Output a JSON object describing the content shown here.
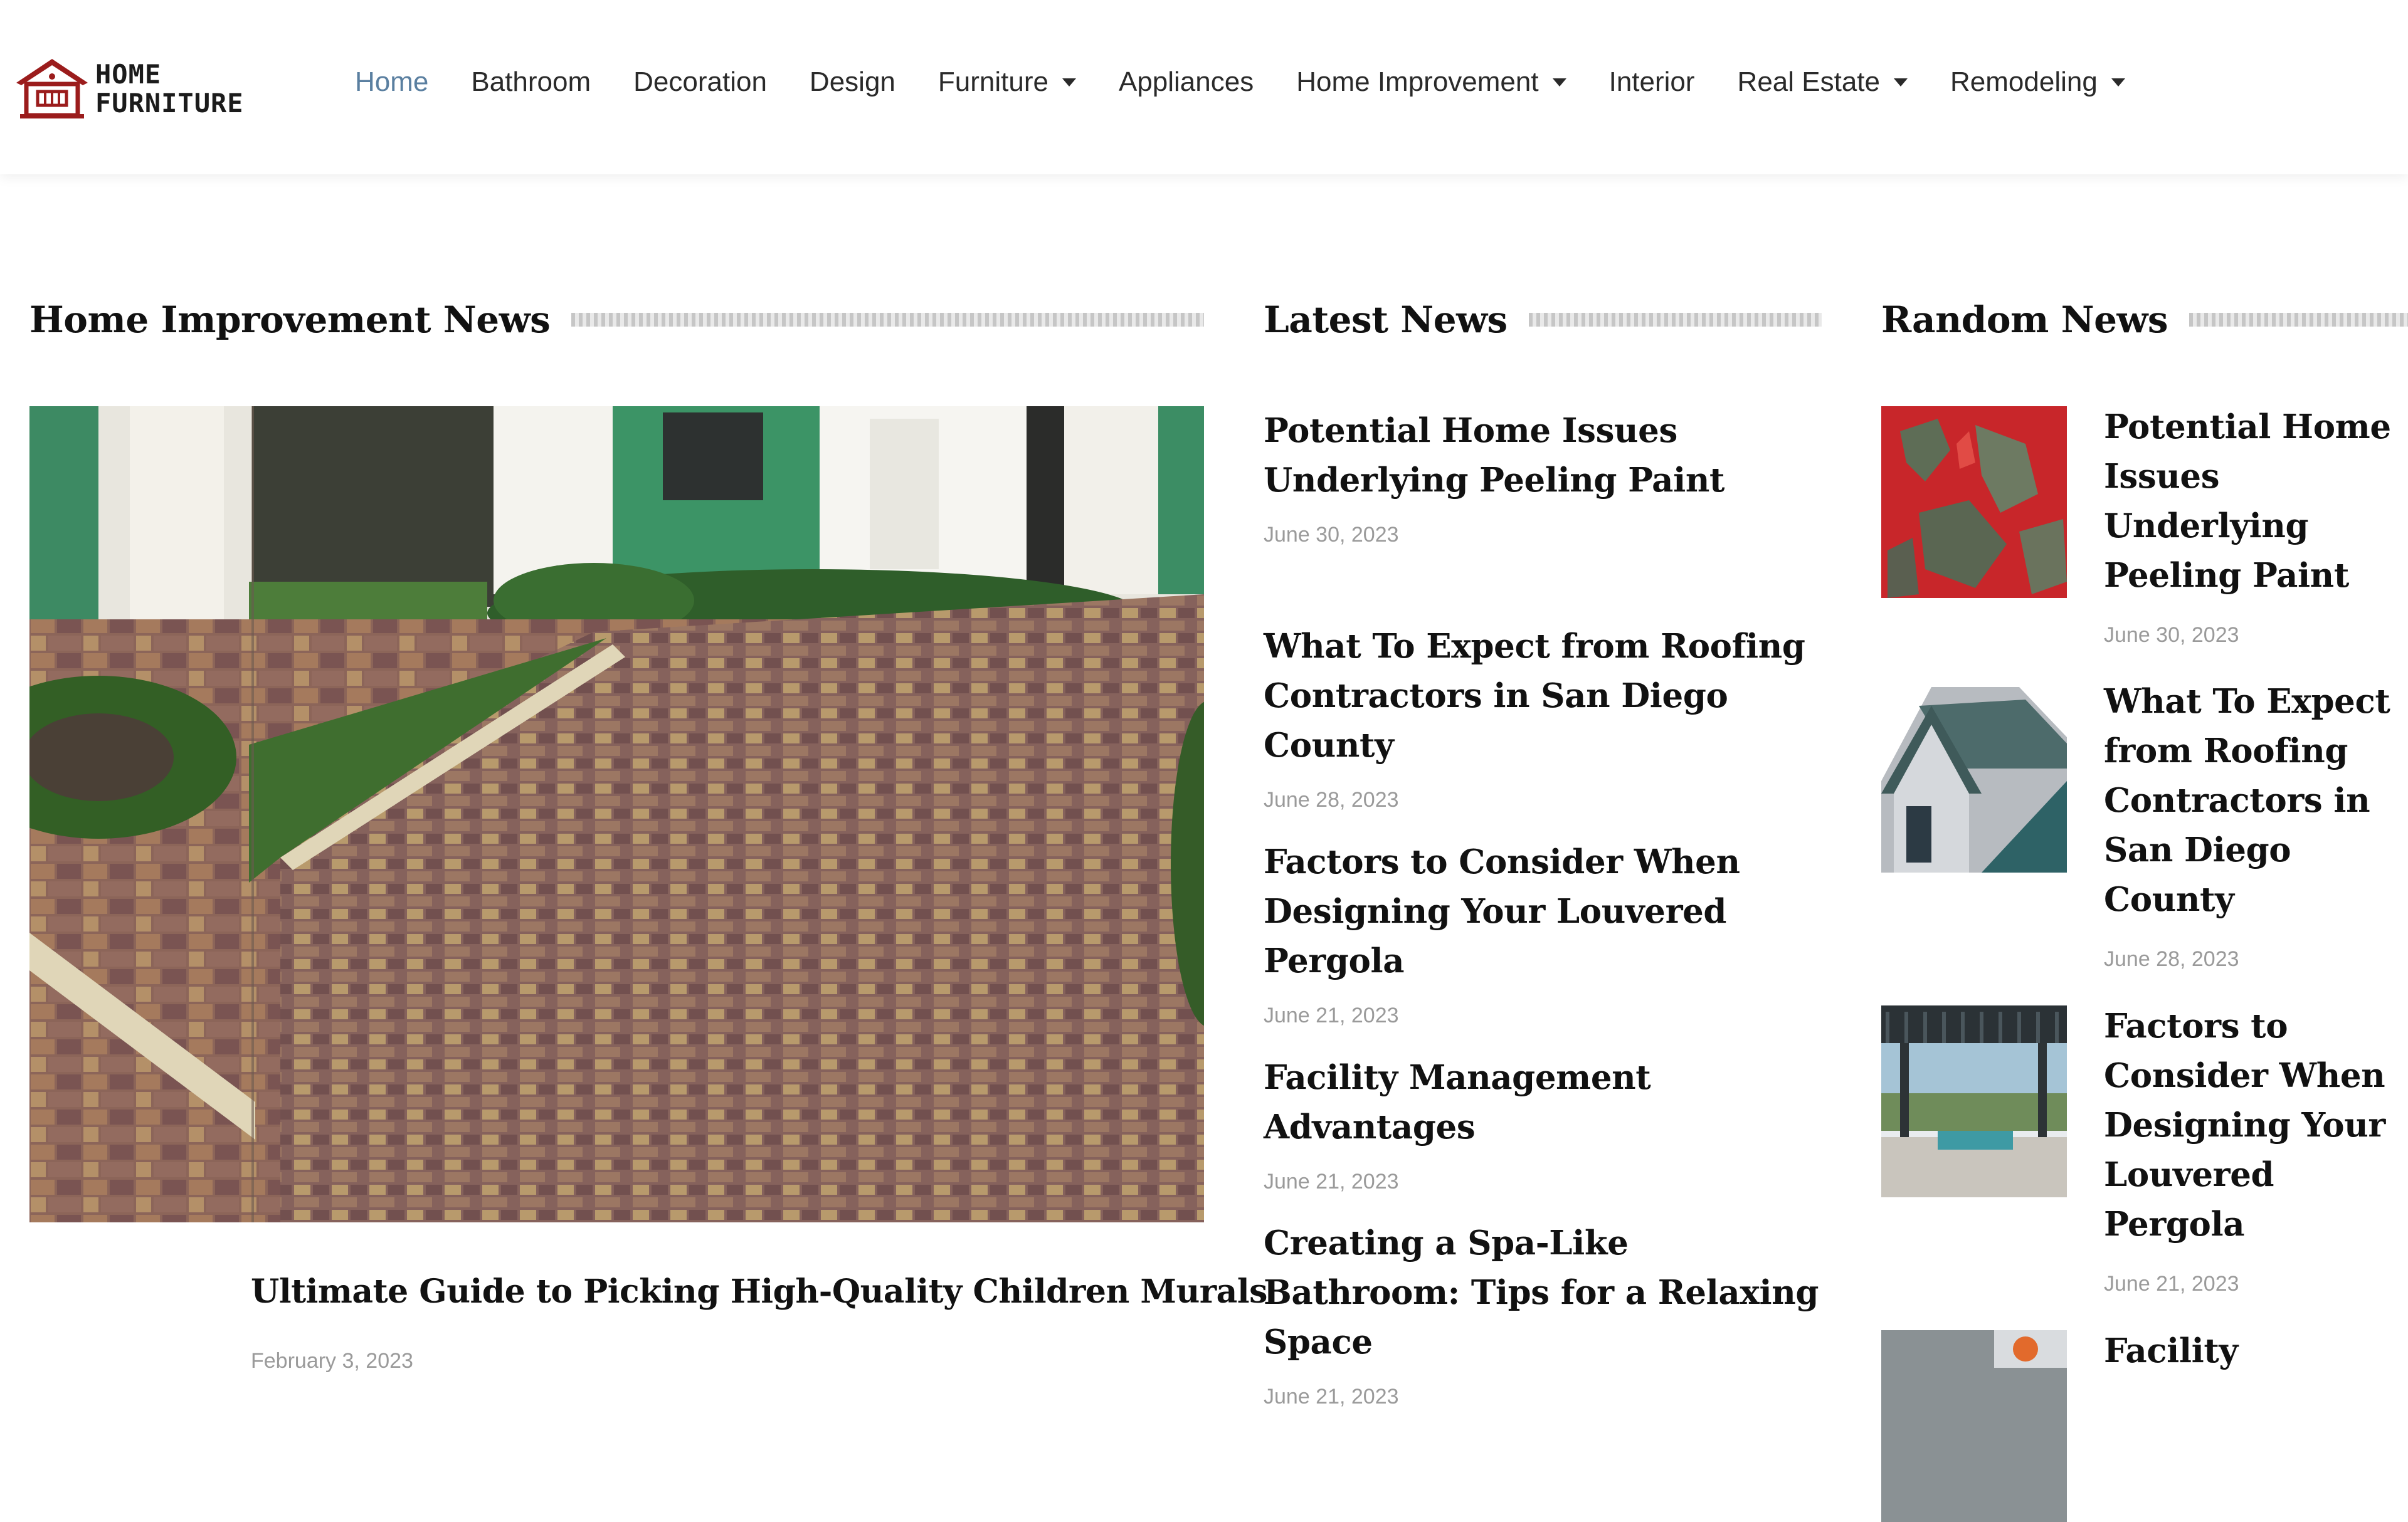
{
  "brand": {
    "line1": "HOME",
    "line2": "FURNITURE",
    "accent_color": "#9b1c1c"
  },
  "nav": {
    "active_color": "#5a7fa0",
    "items": [
      {
        "label": "Home",
        "active": true,
        "dropdown": false
      },
      {
        "label": "Bathroom",
        "dropdown": false
      },
      {
        "label": "Decoration",
        "dropdown": false
      },
      {
        "label": "Design",
        "dropdown": false
      },
      {
        "label": "Furniture",
        "dropdown": true
      },
      {
        "label": "Appliances",
        "dropdown": false
      },
      {
        "label": "Home Improvement",
        "dropdown": true
      },
      {
        "label": "Interior",
        "dropdown": false
      },
      {
        "label": "Real Estate",
        "dropdown": true
      },
      {
        "label": "Remodeling",
        "dropdown": true
      }
    ]
  },
  "sections": {
    "home_improvement": "Home Improvement News",
    "latest": "Latest News",
    "random": "Random News"
  },
  "featured": {
    "title": "Ultimate Guide to Picking High-Quality Children Murals",
    "date": "February 3, 2023"
  },
  "latest": [
    {
      "title": "Potential Home Issues Underlying Peeling Paint",
      "date": "June 30, 2023"
    },
    {
      "title": "What To Expect from Roofing Contractors in San Diego County",
      "date": "June 28, 2023"
    },
    {
      "title": "Factors to Consider When Designing Your Louvered Pergola",
      "date": "June 21, 2023"
    },
    {
      "title": "Facility Management Advantages",
      "date": "June 21, 2023"
    },
    {
      "title": "Creating a Spa-Like Bathroom: Tips for a Relaxing Space",
      "date": "June 21, 2023"
    }
  ],
  "random": [
    {
      "title": "Potential Home Issues Underlying Peeling Paint",
      "date": "June 30, 2023"
    },
    {
      "title": "What To Expect from Roofing Contractors in San Diego County",
      "date": "June 28, 2023"
    },
    {
      "title": "Factors to Consider When Designing Your Louvered Pergola",
      "date": "June 21, 2023"
    },
    {
      "title": "Facility"
    }
  ]
}
